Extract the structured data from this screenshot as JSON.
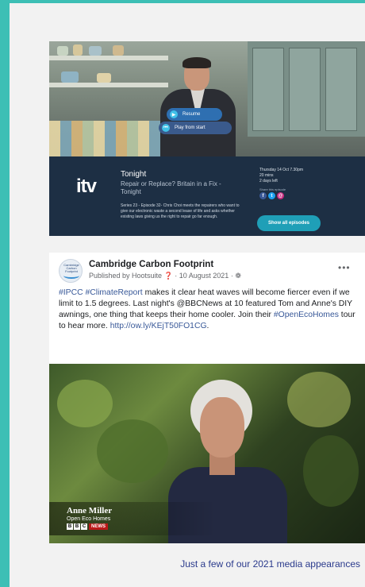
{
  "colors": {
    "accent": "#3dbfb5",
    "itv_panel": "#1d2f44",
    "link": "#385898",
    "caption": "#2a3a8c"
  },
  "itv": {
    "logo": "itv",
    "resume_label": "Resume",
    "play_label": "Play from start",
    "show_title": "Tonight",
    "show_subtitle": "Repair or Replace? Britain in a Fix - Tonight",
    "description": "Series 23 - Episode 32- Chris Choi meets the repairers who want to give our electronic waste a second lease of life and asks whether existing laws giving us the right to repair go far enough.",
    "meta_date": "Thursday 14 Oct 7.30pm",
    "meta_duration": "20 mins",
    "meta_left": "2 days left",
    "share_label": "Share this episode",
    "show_all_label": "Show all episodes"
  },
  "post": {
    "avatar_text": "Cambridge Carbon Footprint",
    "author": "Cambridge Carbon Footprint",
    "published": "Published by Hootsuite ❓ · 10 August 2021 · ❁",
    "more_icon": "more-dots-icon",
    "tag1": "#IPCC",
    "tag2": "#ClimateReport",
    "text1": " makes it clear heat waves will become fiercer even if we limit to 1.5 degrees. Last night's @BBCNews at 10 featured Tom and Anne's DIY awnings, one thing that keeps their home cooler. Join their ",
    "tag3": "#OpenEcoHomes",
    "text2": " tour to hear more. ",
    "link": "http://ow.ly/KEjT50FO1CG",
    "text3": ".",
    "video_name": "Anne Miller",
    "video_org": "Open Eco Homes",
    "bbc_letters": [
      "B",
      "B",
      "C"
    ],
    "bbc_news": "NEWS"
  },
  "footer_caption": "Just a few of our 2021 media appearances"
}
